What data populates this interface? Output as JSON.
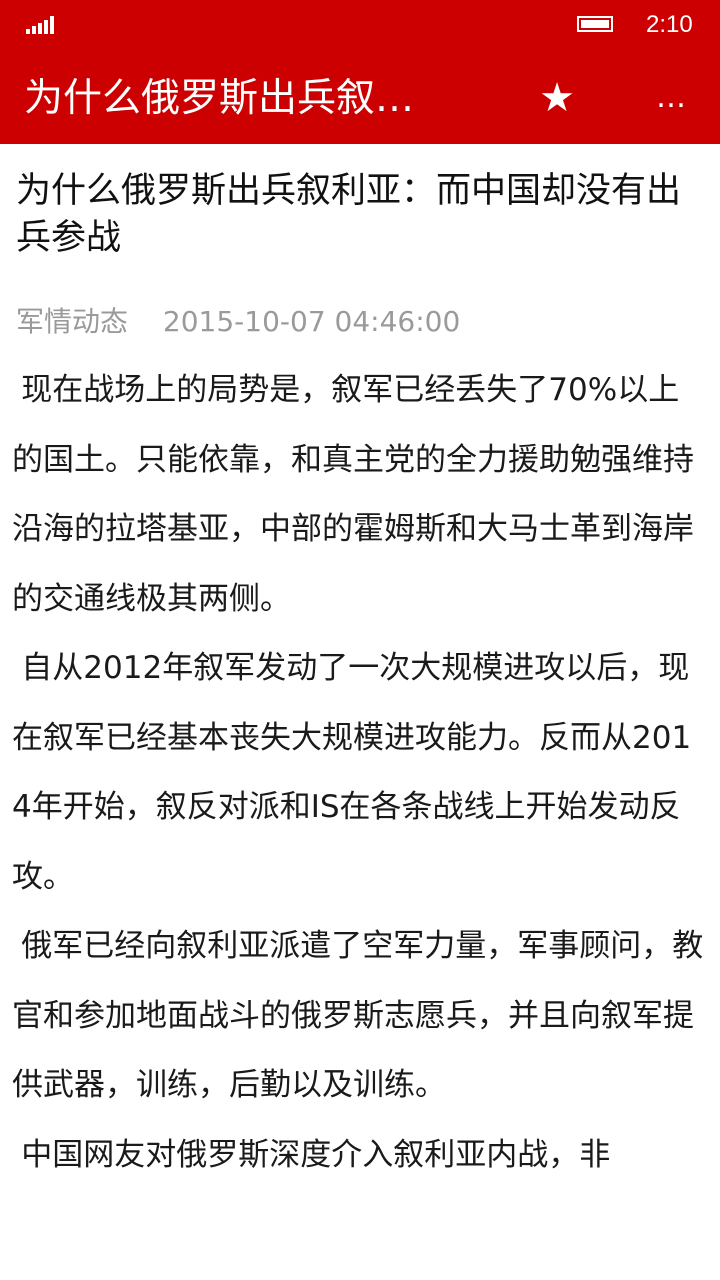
{
  "status_bar": {
    "time": "2:10",
    "signal_icon": "signal-bars-icon",
    "battery_icon": "battery-icon"
  },
  "app_bar": {
    "title": "为什么俄罗斯出兵叙…",
    "star_glyph": "★",
    "more_glyph": "…"
  },
  "article": {
    "title": "为什么俄罗斯出兵叙利亚：而中国却没有出兵参战",
    "category": "军情动态",
    "datetime": "2015-10-07 04:46:00",
    "paragraphs": [
      "现在战场上的局势是，叙军已经丢失了70%以上的国土。只能依靠，和真主党的全力援助勉强维持沿海的拉塔基亚，中部的霍姆斯和大马士革到海岸的交通线极其两侧。",
      "自从2012年叙军发动了一次大规模进攻以后，现在叙军已经基本丧失大规模进攻能力。反而从2014年开始，叙反对派和IS在各条战线上开始发动反攻。",
      "俄军已经向叙利亚派遣了空军力量，军事顾问，教官和参加地面战斗的俄罗斯志愿兵，并且向叙军提供武器，训练，后勤以及训练。",
      "中国网友对俄罗斯深度介入叙利亚内战，非"
    ]
  },
  "colors": {
    "accent": "#cc0000",
    "text": "#1a1a1a",
    "meta": "#9a9a9a",
    "background": "#ffffff"
  }
}
